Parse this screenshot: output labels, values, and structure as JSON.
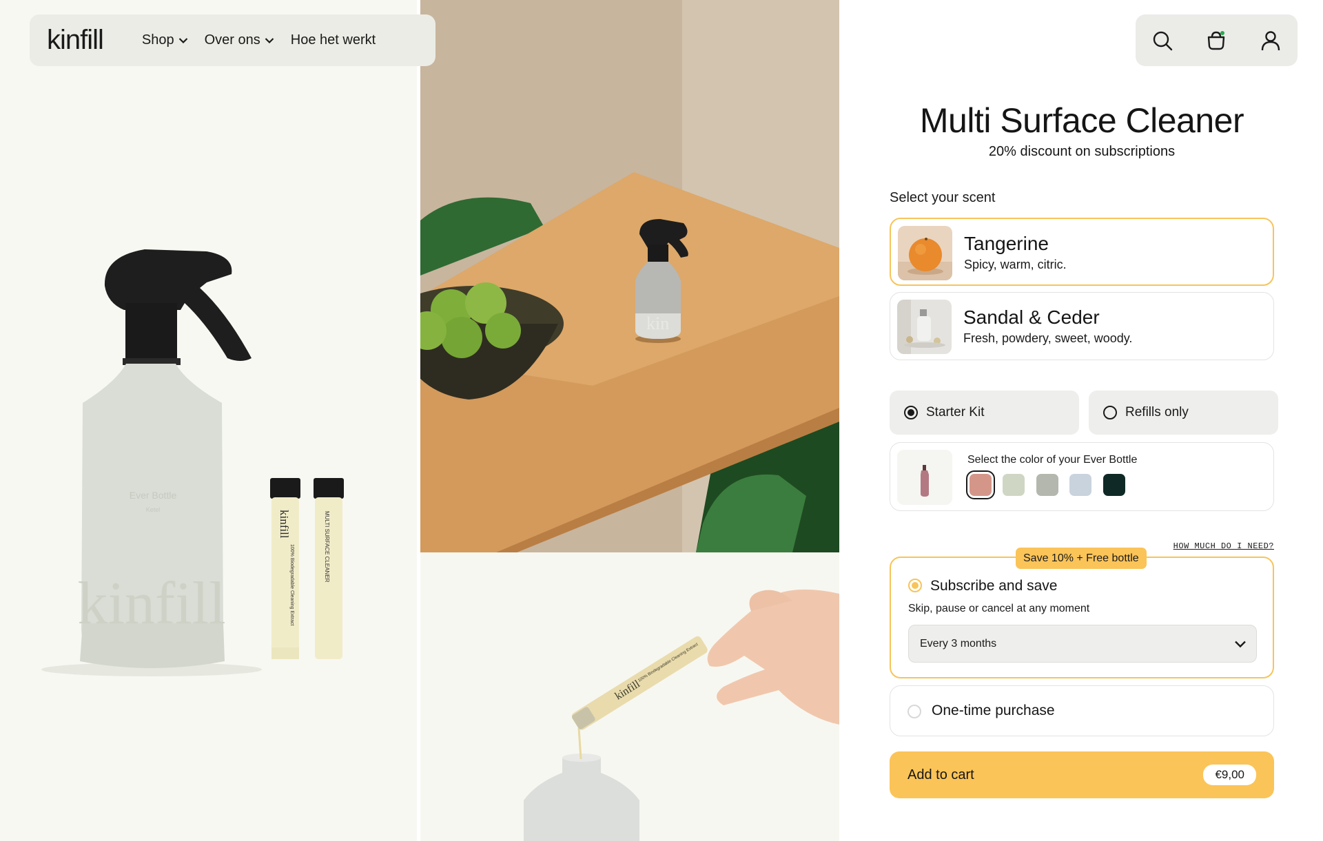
{
  "nav": {
    "logo": "kinfill",
    "items": [
      {
        "label": "Shop",
        "has_dropdown": true
      },
      {
        "label": "Over ons",
        "has_dropdown": true
      },
      {
        "label": "Hoe het werkt",
        "has_dropdown": false
      }
    ],
    "icons": [
      "search-icon",
      "cart-icon",
      "account-icon"
    ]
  },
  "gallery": {
    "bottle_print": "kinfill",
    "bottle_label": "Ever Bottle",
    "bottle_label_sub": "Ketel",
    "refill_1_brand": "kinfill",
    "refill_1_text": "100% Biodegradable Cleaning Extract",
    "refill_2_text": "MULTI SURFACE CLEANER",
    "refill_3_brand": "kinfill",
    "refill_3_text": "100% Biodegradable Cleaning Extract",
    "silver_bottle_print": "kin"
  },
  "product": {
    "title": "Multi Surface Cleaner",
    "subtitle": "20% discount on subscriptions",
    "scent_label": "Select your scent",
    "scents": [
      {
        "name": "Tangerine",
        "desc": "Spicy, warm, citric.",
        "selected": true
      },
      {
        "name": "Sandal & Ceder",
        "desc": "Fresh, powdery, sweet, woody.",
        "selected": false
      }
    ],
    "kit_options": [
      {
        "label": "Starter Kit",
        "selected": true
      },
      {
        "label": "Refills only",
        "selected": false
      }
    ],
    "color_label": "Select the color of your Ever Bottle",
    "colors": [
      "#d5968a",
      "#cfd7c4",
      "#b4b7ae",
      "#c9d3de",
      "#0f2a26"
    ],
    "selected_color_index": 0,
    "how_much_link": "HOW MUCH DO I NEED?",
    "subscription": {
      "badge": "Save 10% + Free bottle",
      "title": "Subscribe and save",
      "desc": "Skip, pause or cancel at any moment",
      "frequency": "Every 3 months"
    },
    "one_time": "One-time purchase",
    "add_to_cart": "Add to cart",
    "price": "€9,00"
  },
  "colors": {
    "accent": "#fbc458",
    "accent_border": "#f7c45a",
    "nav_bg": "#ebece5"
  }
}
